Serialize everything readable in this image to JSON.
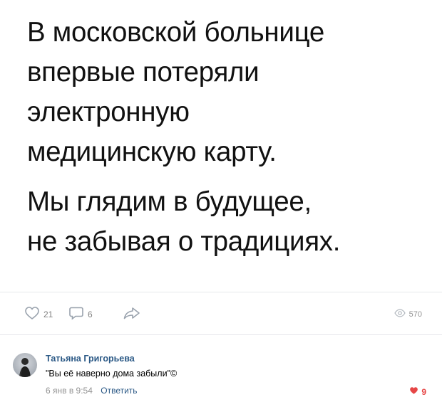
{
  "post": {
    "paragraph1_lines": [
      "В московской больнице",
      "впервые потеряли",
      "электронную",
      "медицинскую карту."
    ],
    "paragraph2_lines": [
      "Мы глядим в будущее,",
      "не забывая о традициях."
    ]
  },
  "actions": {
    "likes": "21",
    "comments": "6",
    "views": "570",
    "icons": {
      "like": "heart-outline-icon",
      "comment": "speech-bubble-icon",
      "share": "share-arrow-icon",
      "views": "eye-icon"
    }
  },
  "comment": {
    "author": "Татьяна Григорьева",
    "text": "\"Вы её наверно дома забыли\"©",
    "date": "6 янв в 9:54",
    "reply_label": "Ответить",
    "likes": "9",
    "colors": {
      "link": "#2a5885",
      "like_active": "#e64646"
    }
  }
}
